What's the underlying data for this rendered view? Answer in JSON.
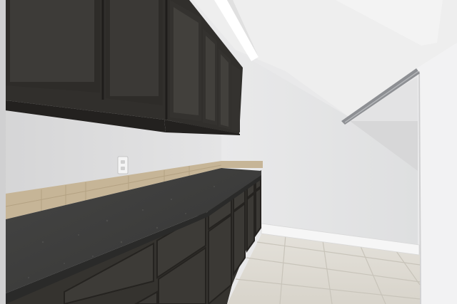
{
  "scene": {
    "subject": "pantry",
    "elements": [
      "upper-cabinets",
      "granite-countertop",
      "stone-backsplash",
      "lower-drawers",
      "lower-cabinets",
      "wall-outlet",
      "ceiling-light",
      "closet-rod",
      "tile-floor",
      "baseboard"
    ]
  },
  "colors": {
    "cabinet": "#3a3835",
    "cabinet_panel": "#2f2d2a",
    "cabinet_edge": "#55524d",
    "countertop": "#3c3c3b",
    "countertop_edge": "#2a2a29",
    "backsplash": "#c7b79b",
    "wall_left": "#dcdcdd",
    "wall_back": "#e6e6e7",
    "ceiling": "#efefef",
    "floor": "#dedbd3",
    "floor_grout": "#c9c5bb",
    "baseboard": "#f4f4f4",
    "light": "#ffffff",
    "rod": "#8d8f93"
  }
}
